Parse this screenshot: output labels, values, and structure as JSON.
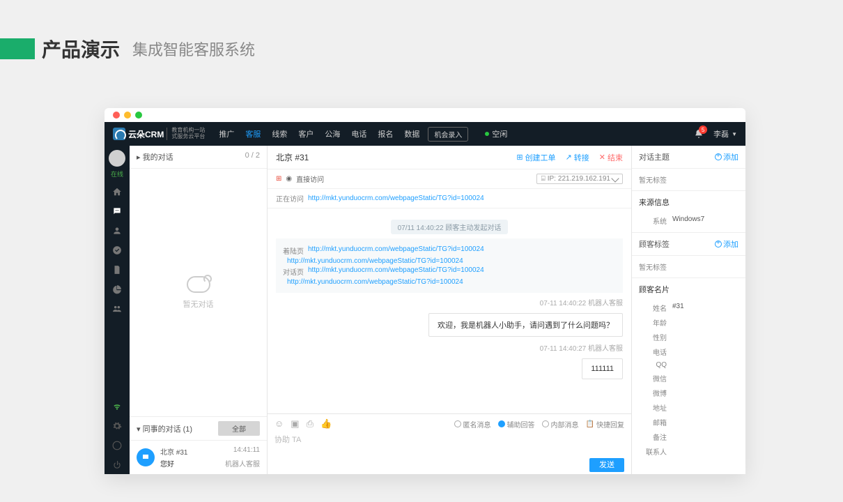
{
  "slide": {
    "title": "产品演示",
    "subtitle": "集成智能客服系统"
  },
  "logo": {
    "name": "云朵CRM",
    "sub1": "教育机构一站",
    "sub2": "式服务云平台"
  },
  "nav": {
    "items": [
      "推广",
      "客服",
      "线索",
      "客户",
      "公海",
      "电话",
      "报名",
      "数据"
    ],
    "active": 1,
    "opportunity_btn": "机会录入",
    "status_text": "空闲"
  },
  "topbar": {
    "notif_count": "5",
    "user_name": "李磊"
  },
  "sidebar": {
    "status": "在线"
  },
  "conversations": {
    "my_title": "我的对话",
    "my_count": "0 / 2",
    "empty": "暂无对话",
    "colleague_title": "同事的对话  (1)",
    "all_btn": "全部",
    "items": [
      {
        "name": "北京  #31",
        "time": "14:41:11",
        "msg": "您好",
        "sub": "机器人客服"
      }
    ]
  },
  "chat": {
    "title": "北京 #31",
    "actions": {
      "create": "创建工单",
      "transfer": "转接",
      "end": "结束"
    },
    "direct_visit": "直接访问",
    "ip_label": "IP:",
    "ip": "221.219.162.191",
    "visiting_label": "正在访问",
    "visiting_url": "http://mkt.yunduocrm.com/webpageStatic/TG?id=100024",
    "sys1": "07/11 14:40:22  顾客主动发起对话",
    "ref_landing": "着陆页",
    "ref_chat": "对话页",
    "ref_url": "http://mkt.yunduocrm.com/webpageStatic/TG?id=100024",
    "ts1": "07-11 14:40:22  机器人客服",
    "bubble1": "欢迎，我是机器人小助手，请问遇到了什么问题吗？",
    "ts2": "07-11 14:40:27  机器人客服",
    "bubble2": "111111",
    "input": {
      "anon": "匿名消息",
      "assist": "辅助回答",
      "internal": "内部消息",
      "quick": "快捷回复",
      "placeholder": "协助 TA",
      "send": "发送"
    }
  },
  "right": {
    "topic": "对话主题",
    "add": "添加",
    "no_tag": "暂无标签",
    "source_title": "来源信息",
    "system_label": "系统",
    "system_val": "Windows7",
    "cust_tag_title": "顾客标签",
    "card_title": "顾客名片",
    "fields": [
      {
        "l": "姓名",
        "v": "#31"
      },
      {
        "l": "年龄",
        "v": ""
      },
      {
        "l": "性别",
        "v": ""
      },
      {
        "l": "电话",
        "v": ""
      },
      {
        "l": "QQ",
        "v": ""
      },
      {
        "l": "微信",
        "v": ""
      },
      {
        "l": "微博",
        "v": ""
      },
      {
        "l": "地址",
        "v": ""
      },
      {
        "l": "邮箱",
        "v": ""
      },
      {
        "l": "备注",
        "v": ""
      },
      {
        "l": "联系人",
        "v": ""
      }
    ]
  }
}
